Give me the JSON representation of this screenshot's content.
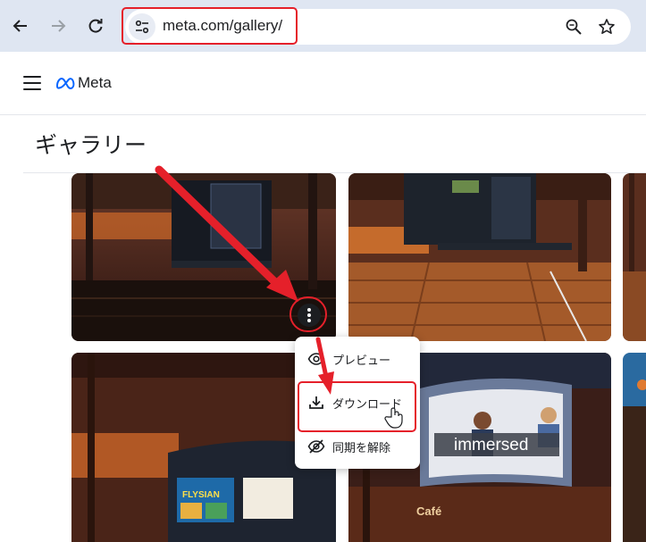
{
  "browser": {
    "url": "meta.com/gallery/",
    "back_icon": "arrow-left-icon",
    "forward_icon": "arrow-right-icon",
    "reload_icon": "reload-icon",
    "site_info_icon": "tune-icon",
    "zoom_icon": "magnifier-icon",
    "bookmark_icon": "star-icon"
  },
  "header": {
    "menu_icon": "hamburger-icon",
    "logo_text": "Meta"
  },
  "page": {
    "title": "ギャラリー"
  },
  "gallery": {
    "tiles": [
      {
        "overlay_text": ""
      },
      {
        "overlay_text": ""
      },
      {
        "overlay_text": ""
      },
      {
        "overlay_text": "FLYSIAN"
      },
      {
        "overlay_text": "immersed"
      },
      {
        "overlay_text": "Café"
      }
    ]
  },
  "context_menu": {
    "items": [
      {
        "label": "プレビュー",
        "icon": "eye-icon"
      },
      {
        "label": "ダウンロード",
        "icon": "download-icon"
      },
      {
        "label": "同期を解除",
        "icon": "eye-off-icon"
      }
    ]
  },
  "colors": {
    "highlight": "#e5202a",
    "browser_bar": "#dfe6f2",
    "meta_blue": "#0866ff"
  }
}
